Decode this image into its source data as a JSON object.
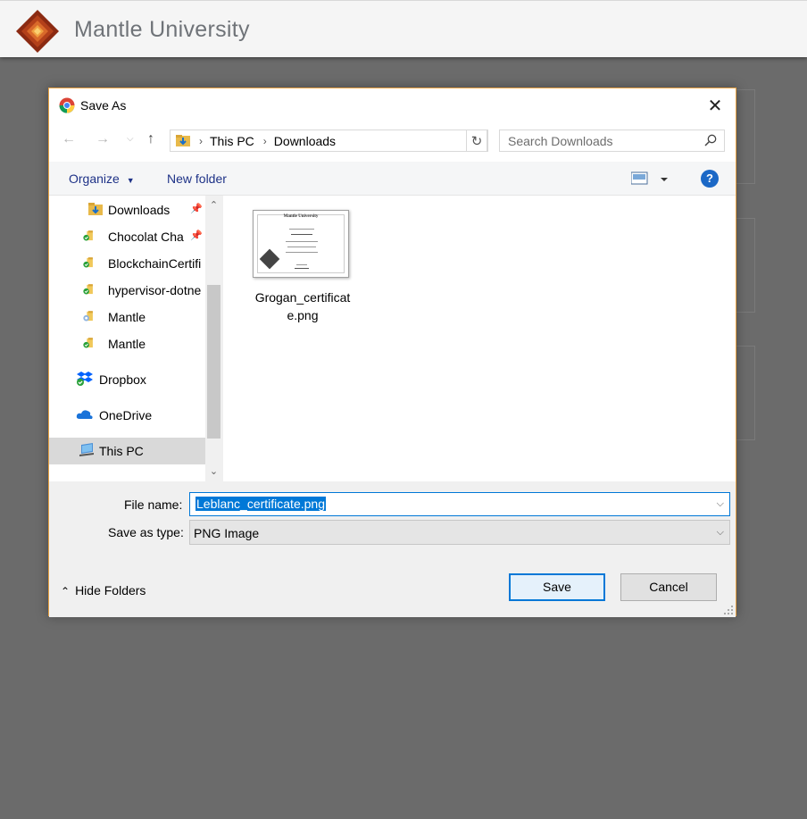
{
  "app": {
    "title": "Mantle University"
  },
  "dialog": {
    "title": "Save As",
    "breadcrumb": [
      "This PC",
      "Downloads"
    ],
    "search_placeholder": "Search Downloads",
    "toolbar": {
      "organize": "Organize",
      "new_folder": "New folder"
    },
    "sidebar": [
      {
        "label": "Downloads",
        "icon": "downloads-folder-icon",
        "pinned": true
      },
      {
        "label": "Chocolat Cha",
        "icon": "synced-folder-icon",
        "pinned": true
      },
      {
        "label": "BlockchainCertifi",
        "icon": "synced-folder-icon",
        "pinned": false
      },
      {
        "label": "hypervisor-dotne",
        "icon": "synced-folder-icon",
        "pinned": false
      },
      {
        "label": "Mantle",
        "icon": "shared-folder-icon",
        "pinned": false
      },
      {
        "label": "Mantle",
        "icon": "synced-folder-icon",
        "pinned": false
      },
      {
        "label": "Dropbox",
        "icon": "dropbox-icon",
        "pinned": false
      },
      {
        "label": "OneDrive",
        "icon": "onedrive-icon",
        "pinned": false
      },
      {
        "label": "This PC",
        "icon": "computer-icon",
        "pinned": false,
        "selected": true
      }
    ],
    "files": [
      {
        "name_line1": "Grogan_certificat",
        "name_line2": "e.png",
        "thumb_title": "Mantle University"
      }
    ],
    "file_name_label": "File name:",
    "file_name_value": "Leblanc_certificate.png",
    "save_type_label": "Save as type:",
    "save_type_value": "PNG Image",
    "hide_folders": "Hide Folders",
    "save_button": "Save",
    "cancel_button": "Cancel"
  },
  "colors": {
    "accent": "#0078d7",
    "dialog_border": "#e8a243",
    "help_blue": "#1b68c6",
    "link_text": "#1e3287"
  }
}
